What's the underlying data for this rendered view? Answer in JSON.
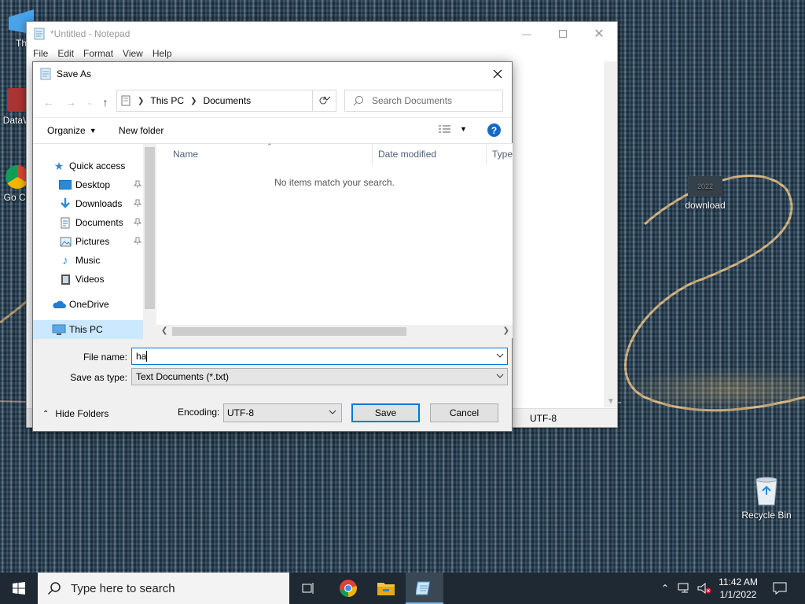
{
  "desktop": {
    "icons": [
      {
        "label": "Th"
      },
      {
        "label": "DataW"
      },
      {
        "label": "Go Ch"
      },
      {
        "label": "download",
        "thumb_text": "2022"
      },
      {
        "label": "Recycle Bin"
      }
    ]
  },
  "notepad": {
    "title": "*Untitled - Notepad",
    "menu": [
      "File",
      "Edit",
      "Format",
      "View",
      "Help"
    ],
    "status_encoding": "UTF-8"
  },
  "dialog": {
    "title": "Save As",
    "breadcrumb": [
      "This PC",
      "Documents"
    ],
    "search_placeholder": "Search Documents",
    "organize_label": "Organize",
    "new_folder_label": "New folder",
    "help_glyph": "?",
    "nav": [
      {
        "label": "Quick access",
        "icon": "star-icon"
      },
      {
        "label": "Desktop",
        "icon": "desktop-folder-icon",
        "pinned": true
      },
      {
        "label": "Downloads",
        "icon": "download-arrow-icon",
        "pinned": true
      },
      {
        "label": "Documents",
        "icon": "document-icon",
        "pinned": true
      },
      {
        "label": "Pictures",
        "icon": "pictures-icon",
        "pinned": true
      },
      {
        "label": "Music",
        "icon": "music-note-icon"
      },
      {
        "label": "Videos",
        "icon": "videos-icon"
      },
      {
        "label": "OneDrive",
        "icon": "cloud-icon"
      },
      {
        "label": "This PC",
        "icon": "computer-icon",
        "selected": true
      }
    ],
    "columns": [
      "Name",
      "Date modified",
      "Type"
    ],
    "empty_message": "No items match your search.",
    "file_name_label": "File name:",
    "file_name_value": "ha",
    "save_type_label": "Save as type:",
    "save_type_value": "Text Documents (*.txt)",
    "hide_folders_label": "Hide Folders",
    "encoding_label": "Encoding:",
    "encoding_value": "UTF-8",
    "save_label": "Save",
    "cancel_label": "Cancel"
  },
  "taskbar": {
    "search_placeholder": "Type here to search",
    "time": "11:42 AM",
    "date": "1/1/2022"
  },
  "colors": {
    "accent": "#0078d7",
    "selection": "#cce8ff",
    "taskbar": "#1f2933"
  }
}
